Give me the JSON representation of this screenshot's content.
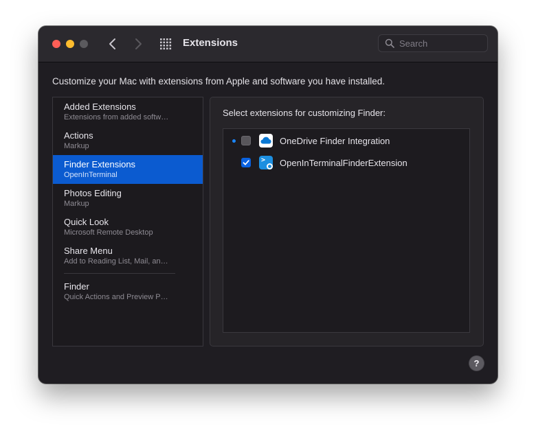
{
  "window": {
    "title": "Extensions",
    "search_placeholder": "Search"
  },
  "colors": {
    "window_bg": "#1f1d22",
    "titlebar_bg": "#2b292e",
    "selection": "#0b5bd0",
    "close": "#ff5f57",
    "minimize": "#febc2e",
    "zoom_disabled": "#5b5a5e",
    "checkbox_on": "#0a62e0",
    "new_dot": "#1a86ff"
  },
  "description": "Customize your Mac with extensions from Apple and software you have installed.",
  "sidebar": {
    "items": [
      {
        "title": "Added Extensions",
        "subtitle": "Extensions from added softw…"
      },
      {
        "title": "Actions",
        "subtitle": "Markup"
      },
      {
        "title": "Finder Extensions",
        "subtitle": "OpenInTerminal",
        "selected": true
      },
      {
        "title": "Photos Editing",
        "subtitle": "Markup"
      },
      {
        "title": "Quick Look",
        "subtitle": "Microsoft Remote Desktop"
      },
      {
        "title": "Share Menu",
        "subtitle": "Add to Reading List, Mail, an…"
      },
      {
        "title": "Finder",
        "subtitle": "Quick Actions and Preview P…"
      }
    ]
  },
  "panel": {
    "label": "Select extensions for customizing Finder:",
    "extensions": [
      {
        "name": "OneDrive Finder Integration",
        "enabled": false,
        "is_new": true,
        "icon": "onedrive-icon"
      },
      {
        "name": "OpenInTerminalFinderExtension",
        "enabled": true,
        "is_new": false,
        "icon": "terminal-icon"
      }
    ]
  },
  "help": {
    "label": "?"
  }
}
